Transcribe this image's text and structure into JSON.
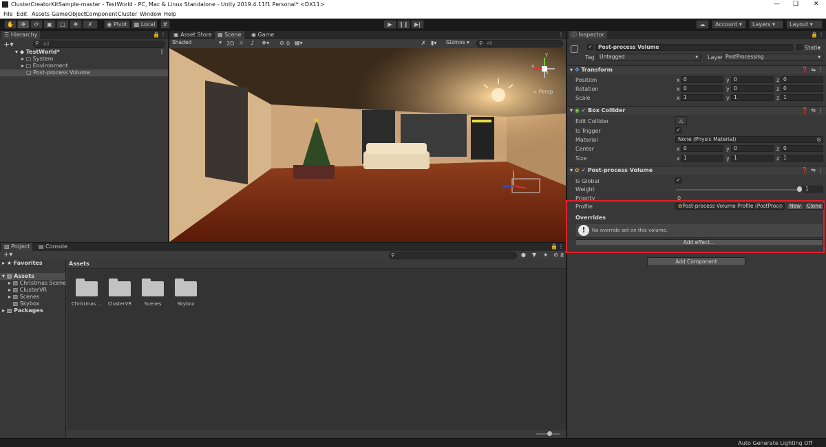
{
  "window": {
    "title": "ClusterCreatorKitSample-master - TestWorld - PC, Mac & Linux Standalone - Unity 2019.4.11f1 Personal* <DX11>"
  },
  "menu": [
    "File",
    "Edit",
    "Assets",
    "GameObject",
    "Component",
    "Cluster",
    "Window",
    "Help"
  ],
  "toolbar": {
    "pivot": "Pivot",
    "local": "Local",
    "account": "Account",
    "layers": "Layers",
    "layout": "Layout"
  },
  "hierarchy": {
    "tab": "Hierarchy",
    "search_placeholder": "All",
    "scene": "TestWorld*",
    "items": [
      "System",
      "Environment",
      "Post-process Volume"
    ]
  },
  "scene_view": {
    "tabs": [
      "Asset Store",
      "Scene",
      "Game"
    ],
    "shading": "Shaded",
    "mode_2d": "2D",
    "hidden_count": "0",
    "gizmos": "Gizmos",
    "search_placeholder": "All",
    "persp": "< Persp"
  },
  "project": {
    "tabs": [
      "Project",
      "Console"
    ],
    "favorites": "Favorites",
    "assets_root": "Assets",
    "tree": [
      "Christmas Scene",
      "ClusterVR",
      "Scenes",
      "Skybox"
    ],
    "packages": "Packages",
    "breadcrumb": "Assets",
    "folders": [
      "Christmas ...",
      "ClusterVR",
      "Scenes",
      "Skybox"
    ],
    "hidden_count": "8"
  },
  "inspector": {
    "tab": "Inspector",
    "object_name": "Post-process Volume",
    "static_label": "Static",
    "tag_label": "Tag",
    "tag_value": "Untagged",
    "layer_label": "Layer",
    "layer_value": "PostProcessing",
    "transform": {
      "title": "Transform",
      "rows": [
        {
          "label": "Position",
          "x": "0",
          "y": "0",
          "z": "0"
        },
        {
          "label": "Rotation",
          "x": "0",
          "y": "0",
          "z": "0"
        },
        {
          "label": "Scale",
          "x": "1",
          "y": "1",
          "z": "1"
        }
      ]
    },
    "box_collider": {
      "title": "Box Collider",
      "edit_collider": "Edit Collider",
      "is_trigger": "Is Trigger",
      "material": "Material",
      "material_value": "None (Physic Material)",
      "center": {
        "label": "Center",
        "x": "0",
        "y": "0",
        "z": "0"
      },
      "size": {
        "label": "Size",
        "x": "1",
        "y": "1",
        "z": "1"
      }
    },
    "post_process_volume": {
      "title": "Post-process Volume",
      "is_global": "Is Global",
      "weight": "Weight",
      "weight_value": "1",
      "weight_fraction": 1.0,
      "priority": "Priority",
      "priority_value": "0",
      "profile": "Profile",
      "profile_value": "Post-process Volume Profile (PostProce",
      "new_button": "New",
      "clone_button": "Clone",
      "overrides": "Overrides",
      "no_override_msg": "No override set on this volume.",
      "add_effect": "Add effect..."
    },
    "add_component": "Add Component",
    "highlight_color": "#e0202a"
  },
  "status_bar": {
    "text": "Auto Generate Lighting Off"
  },
  "axis_labels": {
    "x": "x",
    "y": "y",
    "z": "z"
  }
}
